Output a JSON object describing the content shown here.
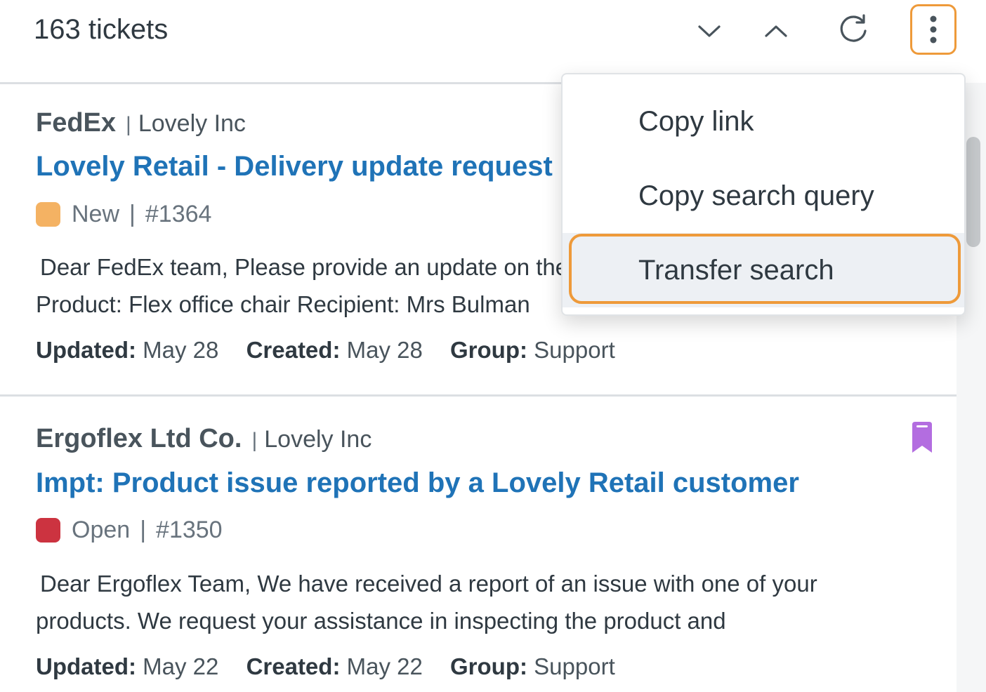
{
  "header": {
    "ticket_count": "163 tickets",
    "icons": {
      "next": "chevron-down-icon",
      "previous": "chevron-up-icon",
      "refresh": "refresh-icon",
      "more": "more-vertical-icon"
    }
  },
  "menu": {
    "items": [
      {
        "label": "Copy link"
      },
      {
        "label": "Copy search query"
      },
      {
        "label": "Transfer search"
      }
    ],
    "highlighted_item": "Transfer search"
  },
  "tickets": [
    {
      "org": "FedEx",
      "brand": "Lovely Inc",
      "subject": "Lovely Retail - Delivery update request",
      "status": "New",
      "status_color": "#f4b263",
      "id": "#1364",
      "preview_lines": [
        "Dear FedEx team, Please provide an update on the delivery of the order below.",
        "Product: Flex office chair Recipient: Mrs Bulman"
      ],
      "updated_label": "Updated:",
      "updated": "May 28",
      "created_label": "Created:",
      "created": "May 28",
      "group_label": "Group:",
      "group": "Support",
      "bookmarked": false
    },
    {
      "org": "Ergoflex Ltd Co.",
      "brand": "Lovely Inc",
      "subject": "Impt: Product issue reported by a Lovely Retail customer",
      "status": "Open",
      "status_color": "#cc3340",
      "id": "#1350",
      "preview_lines": [
        "Dear Ergoflex Team, We have received a report of an issue with one of your",
        "products. We request your assistance in inspecting the product and"
      ],
      "updated_label": "Updated:",
      "updated": "May 22",
      "created_label": "Created:",
      "created": "May 22",
      "group_label": "Group:",
      "group": "Support",
      "bookmarked": true,
      "bookmark_color": "#b36de0"
    }
  ],
  "colors": {
    "link": "#1f73b7",
    "focus_ring": "#ee9a3a",
    "menu_highlight": "#edf0f4"
  }
}
